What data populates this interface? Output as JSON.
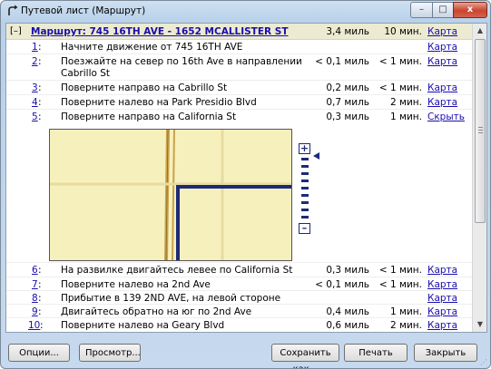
{
  "window": {
    "title": "Путевой лист (Маршрут)",
    "min_glyph": "–",
    "max_glyph": "□",
    "close_glyph": "x"
  },
  "route": {
    "toggle": "[–]",
    "title": "Маршрут: 745 16TH AVE - 1652 MCALLISTER ST",
    "distance": "3,4 миль",
    "time": "10 мин.",
    "link": "Карта"
  },
  "steps": [
    {
      "num": "1",
      "text": "Начните движение от 745 16TH AVE",
      "distance": "",
      "time": "",
      "link": "Карта"
    },
    {
      "num": "2",
      "text": "Поезжайте на север по 16th Ave в направлении Cabrillo St",
      "distance": "< 0,1 миль",
      "time": "< 1 мин.",
      "link": "Карта"
    },
    {
      "num": "3",
      "text": "Поверните направо на Cabrillo St",
      "distance": "0,2 миль",
      "time": "< 1 мин.",
      "link": "Карта"
    },
    {
      "num": "4",
      "text": "Поверните налево на Park Presidio Blvd",
      "distance": "0,7 миль",
      "time": "2 мин.",
      "link": "Карта"
    },
    {
      "num": "5",
      "text": "Поверните направо на California St",
      "distance": "0,3 миль",
      "time": "1 мин.",
      "link": "Скрыть"
    },
    {
      "num": "6",
      "text": "На развилке двигайтесь левее по California St",
      "distance": "0,3 миль",
      "time": "< 1 мин.",
      "link": "Карта"
    },
    {
      "num": "7",
      "text": "Поверните налево на 2nd Ave",
      "distance": "< 0,1 миль",
      "time": "< 1 мин.",
      "link": "Карта"
    },
    {
      "num": "8",
      "text": "Прибытие в 139 2ND AVE, на левой стороне",
      "distance": "",
      "time": "",
      "link": "Карта"
    },
    {
      "num": "9",
      "text": "Двигайтесь обратно на юг по 2nd Ave",
      "distance": "0,4 миль",
      "time": "1 мин.",
      "link": "Карта"
    },
    {
      "num": "10",
      "text": "Поверните налево на Geary Blvd",
      "distance": "0,6 миль",
      "time": "2 мин.",
      "link": "Карта"
    }
  ],
  "map": {
    "zoom_in": "+",
    "zoom_out": "–",
    "land_color": "#f6f0bd",
    "road_color": "#c9a24a",
    "route_color": "#1c2a78"
  },
  "buttons": {
    "options": "Опции...",
    "preview": "Просмотр...",
    "save_as": "Сохранить как...",
    "print": "Печать",
    "close": "Закрыть"
  },
  "icons": {
    "title": "route-arrow-icon",
    "scroll_up": "▲",
    "scroll_down": "▼",
    "resize": "⋰"
  }
}
